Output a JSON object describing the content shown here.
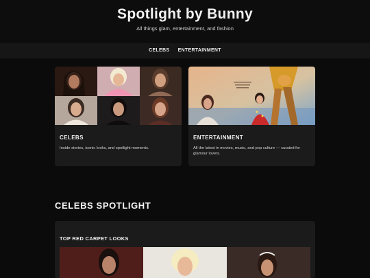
{
  "header": {
    "title": "Spotlight by Bunny",
    "tagline": "All things glam, entertainment, and fashion"
  },
  "nav": {
    "items": [
      {
        "label": "CELEBS"
      },
      {
        "label": "ENTERTAINMENT"
      }
    ]
  },
  "cards": [
    {
      "title": "CELEBS",
      "description": "Inside stories, iconic looks, and spotlight moments."
    },
    {
      "title": "ENTERTAINMENT",
      "description": "All the latest in movies, music, and pop culture — curated for glamour lovers."
    }
  ],
  "spotlight": {
    "heading": "CELEBS SPOTLIGHT",
    "subheading": "TOP RED CARPET LOOKS"
  },
  "colors": {
    "background": "#0b0b0b",
    "header": "#0d0d0d",
    "nav": "#161616",
    "card": "#1b1b1b"
  }
}
